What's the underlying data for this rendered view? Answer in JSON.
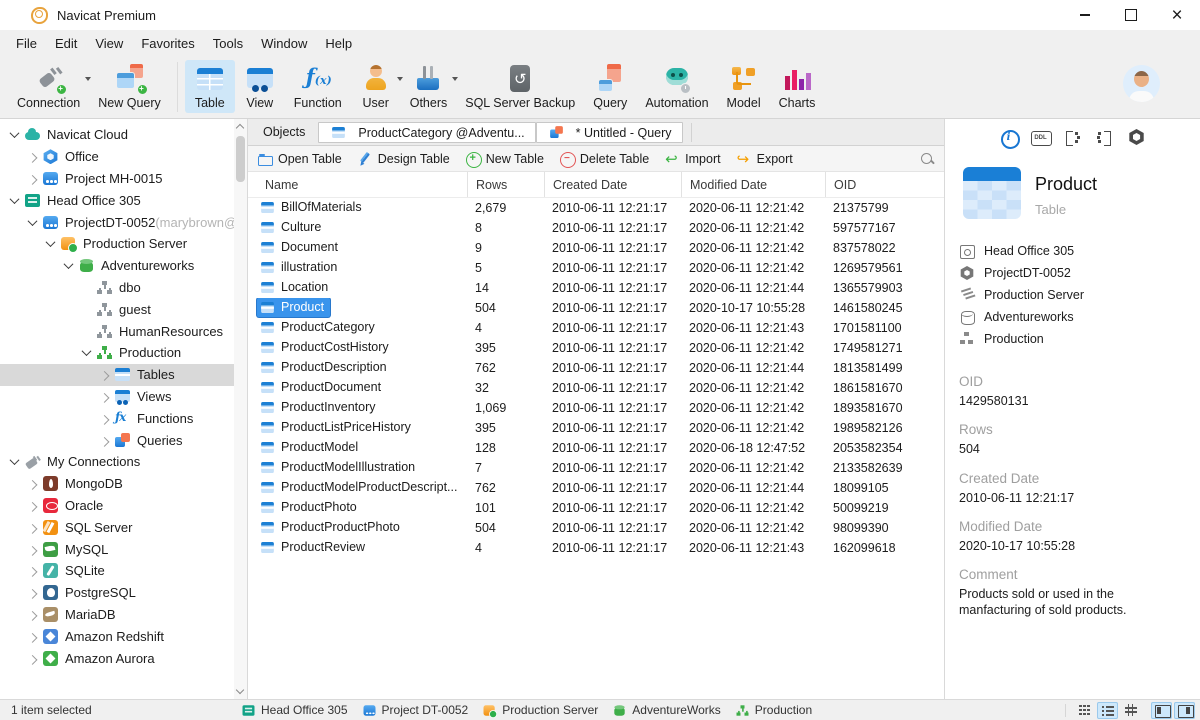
{
  "window": {
    "title": "Navicat Premium"
  },
  "menu": {
    "items": [
      "File",
      "Edit",
      "View",
      "Favorites",
      "Tools",
      "Window",
      "Help"
    ]
  },
  "toolbar": {
    "buttons": [
      {
        "label": "Connection",
        "icon": "connection-icon",
        "dropdown": true,
        "badge": "plus"
      },
      {
        "label": "New Query",
        "icon": "new-query-icon",
        "badge": "plus"
      },
      {
        "label": "Table",
        "icon": "table-icon",
        "active": true
      },
      {
        "label": "View",
        "icon": "view-icon"
      },
      {
        "label": "Function",
        "icon": "function-icon"
      },
      {
        "label": "User",
        "icon": "user-icon",
        "dropdown": true
      },
      {
        "label": "Others",
        "icon": "others-icon",
        "dropdown": true
      },
      {
        "label": "SQL Server Backup",
        "icon": "sql-server-backup-icon"
      },
      {
        "label": "Query",
        "icon": "query-icon"
      },
      {
        "label": "Automation",
        "icon": "automation-icon",
        "badge": "clock"
      },
      {
        "label": "Model",
        "icon": "model-icon"
      },
      {
        "label": "Charts",
        "icon": "charts-icon"
      }
    ]
  },
  "sidebar": {
    "items": [
      {
        "label": "Navicat Cloud",
        "level": 0,
        "chevron": "down",
        "icon": "cloud"
      },
      {
        "label": "Office",
        "level": 1,
        "chevron": "right",
        "icon": "office"
      },
      {
        "label": "Project MH-0015",
        "level": 1,
        "chevron": "right",
        "icon": "project"
      },
      {
        "label": "Head Office 305",
        "level": 0,
        "chevron": "down",
        "icon": "head-office"
      },
      {
        "label": "ProjectDT-0052",
        "suffix": " (marybrown@",
        "level": 1,
        "chevron": "down",
        "icon": "project"
      },
      {
        "label": "Production Server",
        "level": 2,
        "chevron": "down",
        "icon": "server"
      },
      {
        "label": "Adventureworks",
        "level": 3,
        "chevron": "down",
        "icon": "database"
      },
      {
        "label": "dbo",
        "level": 4,
        "chevron": "none",
        "icon": "schema"
      },
      {
        "label": "guest",
        "level": 4,
        "chevron": "none",
        "icon": "schema"
      },
      {
        "label": "HumanResources",
        "level": 4,
        "chevron": "none",
        "icon": "schema"
      },
      {
        "label": "Production",
        "level": 4,
        "chevron": "down",
        "icon": "schema-active"
      },
      {
        "label": "Tables",
        "level": 5,
        "chevron": "right",
        "icon": "tables",
        "selected": true
      },
      {
        "label": "Views",
        "level": 5,
        "chevron": "right",
        "icon": "views"
      },
      {
        "label": "Functions",
        "level": 5,
        "chevron": "right",
        "icon": "functions"
      },
      {
        "label": "Queries",
        "level": 5,
        "chevron": "right",
        "icon": "queries"
      },
      {
        "label": "My Connections",
        "level": 0,
        "chevron": "down",
        "icon": "connections"
      },
      {
        "label": "MongoDB",
        "level": 1,
        "chevron": "right",
        "icon": "mongodb"
      },
      {
        "label": "Oracle",
        "level": 1,
        "chevron": "right",
        "icon": "oracle"
      },
      {
        "label": "SQL Server",
        "level": 1,
        "chevron": "right",
        "icon": "sqlserver"
      },
      {
        "label": "MySQL",
        "level": 1,
        "chevron": "right",
        "icon": "mysql"
      },
      {
        "label": "SQLite",
        "level": 1,
        "chevron": "right",
        "icon": "sqlite"
      },
      {
        "label": "PostgreSQL",
        "level": 1,
        "chevron": "right",
        "icon": "postgresql"
      },
      {
        "label": "MariaDB",
        "level": 1,
        "chevron": "right",
        "icon": "mariadb"
      },
      {
        "label": "Amazon Redshift",
        "level": 1,
        "chevron": "right",
        "icon": "redshift"
      },
      {
        "label": "Amazon Aurora",
        "level": 1,
        "chevron": "right",
        "icon": "aurora"
      }
    ]
  },
  "tabs": {
    "items": [
      {
        "label": "Objects",
        "icon": null,
        "active": true
      },
      {
        "label": "ProductCategory @Adventu...",
        "icon": "tables"
      },
      {
        "label": "* Untitled - Query",
        "icon": "queries"
      }
    ]
  },
  "object_toolbar": {
    "buttons": [
      {
        "label": "Open Table",
        "icon": "open-table-icon"
      },
      {
        "label": "Design Table",
        "icon": "design-table-icon"
      },
      {
        "label": "New Table",
        "icon": "new-table-icon"
      },
      {
        "label": "Delete Table",
        "icon": "delete-table-icon"
      },
      {
        "label": "Import",
        "icon": "import-icon"
      },
      {
        "label": "Export",
        "icon": "export-icon"
      }
    ]
  },
  "object_table": {
    "columns": [
      "Name",
      "Rows",
      "Created Date",
      "Modified Date",
      "OID"
    ],
    "selected_row": "Product",
    "rows": [
      {
        "name": "BillOfMaterials",
        "rows": "2,679",
        "created": "2010-06-11 12:21:17",
        "modified": "2020-06-11 12:21:42",
        "oid": "21375799"
      },
      {
        "name": "Culture",
        "rows": "8",
        "created": "2010-06-11 12:21:17",
        "modified": "2020-06-11 12:21:42",
        "oid": "597577167"
      },
      {
        "name": "Document",
        "rows": "9",
        "created": "2010-06-11 12:21:17",
        "modified": "2020-06-11 12:21:42",
        "oid": "837578022"
      },
      {
        "name": "illustration",
        "rows": "5",
        "created": "2010-06-11 12:21:17",
        "modified": "2020-06-11 12:21:42",
        "oid": "1269579561"
      },
      {
        "name": "Location",
        "rows": "14",
        "created": "2010-06-11 12:21:17",
        "modified": "2020-06-11 12:21:44",
        "oid": "1365579903"
      },
      {
        "name": "Product",
        "rows": "504",
        "created": "2010-06-11 12:21:17",
        "modified": "2020-10-17 10:55:28",
        "oid": "1461580245"
      },
      {
        "name": "ProductCategory",
        "rows": "4",
        "created": "2010-06-11 12:21:17",
        "modified": "2020-06-11 12:21:43",
        "oid": "1701581100"
      },
      {
        "name": "ProductCostHistory",
        "rows": "395",
        "created": "2010-06-11 12:21:17",
        "modified": "2020-06-11 12:21:42",
        "oid": "1749581271"
      },
      {
        "name": "ProductDescription",
        "rows": "762",
        "created": "2010-06-11 12:21:17",
        "modified": "2020-06-11 12:21:44",
        "oid": "1813581499"
      },
      {
        "name": "ProductDocument",
        "rows": "32",
        "created": "2010-06-11 12:21:17",
        "modified": "2020-06-11 12:21:42",
        "oid": "1861581670"
      },
      {
        "name": "ProductInventory",
        "rows": "1,069",
        "created": "2010-06-11 12:21:17",
        "modified": "2020-06-11 12:21:42",
        "oid": "1893581670"
      },
      {
        "name": "ProductListPriceHistory",
        "rows": "395",
        "created": "2010-06-11 12:21:17",
        "modified": "2020-06-11 12:21:42",
        "oid": "1989582126"
      },
      {
        "name": "ProductModel",
        "rows": "128",
        "created": "2010-06-11 12:21:17",
        "modified": "2020-06-18 12:47:52",
        "oid": "2053582354"
      },
      {
        "name": "ProductModelIllustration",
        "rows": "7",
        "created": "2010-06-11 12:21:17",
        "modified": "2020-06-11 12:21:42",
        "oid": "2133582639"
      },
      {
        "name": "ProductModelProductDescript...",
        "rows": "762",
        "created": "2010-06-11 12:21:17",
        "modified": "2020-06-11 12:21:44",
        "oid": "18099105"
      },
      {
        "name": "ProductPhoto",
        "rows": "101",
        "created": "2010-06-11 12:21:17",
        "modified": "2020-06-11 12:21:42",
        "oid": "50099219"
      },
      {
        "name": "ProductProductPhoto",
        "rows": "504",
        "created": "2010-06-11 12:21:17",
        "modified": "2020-06-11 12:21:42",
        "oid": "98099390"
      },
      {
        "name": "ProductReview",
        "rows": "4",
        "created": "2010-06-11 12:21:17",
        "modified": "2020-06-11 12:21:43",
        "oid": "162099618"
      }
    ]
  },
  "info_panel": {
    "tools": [
      {
        "name": "info",
        "active": true
      },
      {
        "name": "ddl"
      },
      {
        "name": "related-objects"
      },
      {
        "name": "dependencies"
      },
      {
        "name": "settings"
      }
    ],
    "title": "Product",
    "subtitle": "Table",
    "breadcrumbs": [
      {
        "label": "Head Office 305",
        "icon": "office-building"
      },
      {
        "label": "ProjectDT-0052",
        "icon": "hexagon"
      },
      {
        "label": "Production Server",
        "icon": "server"
      },
      {
        "label": "Adventureworks",
        "icon": "db"
      },
      {
        "label": "Production",
        "icon": "schema"
      }
    ],
    "fields": [
      {
        "label": "OID",
        "value": "1429580131"
      },
      {
        "label": "Rows",
        "value": "504"
      },
      {
        "label": "Created Date",
        "value": "2010-06-11 12:21:17"
      },
      {
        "label": "Modified Date",
        "value": "2020-10-17 10:55:28"
      },
      {
        "label": "Comment",
        "value": "Products sold or used in the manfacturing of sold products."
      }
    ]
  },
  "status_bar": {
    "left": "1 item selected",
    "path": [
      {
        "label": "Head Office 305",
        "icon": "head-office"
      },
      {
        "label": "Project DT-0052",
        "icon": "project"
      },
      {
        "label": "Production Server",
        "icon": "server"
      },
      {
        "label": "AdventureWorks",
        "icon": "database"
      },
      {
        "label": "Production",
        "icon": "schema-active"
      }
    ],
    "view_toggles": [
      {
        "name": "grid-view",
        "active": false
      },
      {
        "name": "list-view",
        "active": true
      },
      {
        "name": "detail-view",
        "active": false
      },
      {
        "name": "left-pane-toggle",
        "active": true,
        "gap": true
      },
      {
        "name": "right-pane-toggle",
        "active": true
      }
    ]
  }
}
